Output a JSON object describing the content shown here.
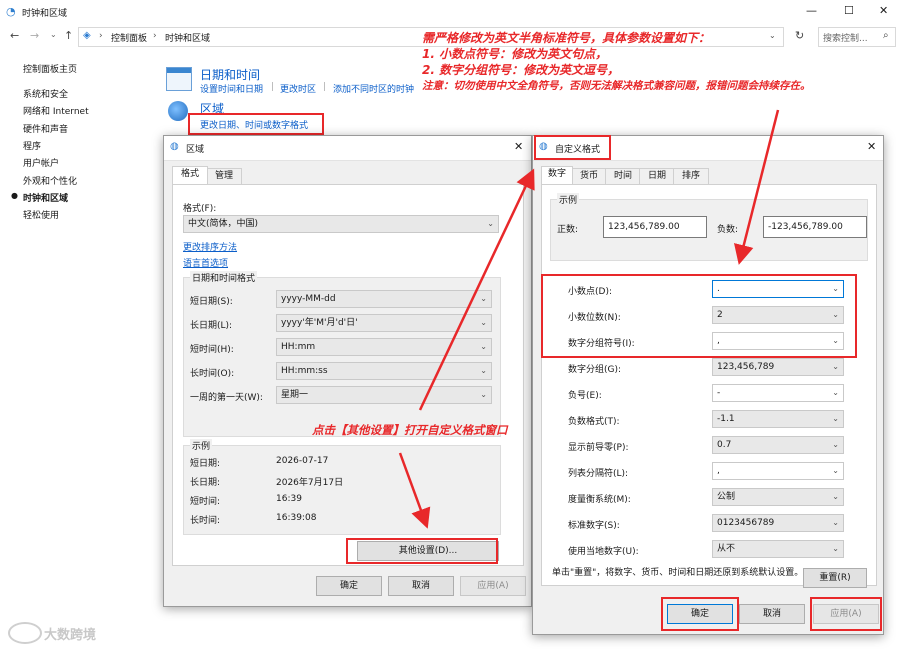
{
  "main_window": {
    "title": "时钟和区域",
    "address": [
      "控制面板",
      "时钟和区域"
    ],
    "search_placeholder": "搜索控制...",
    "win_controls": [
      "—",
      "☐",
      "✕"
    ]
  },
  "left_nav": {
    "items": [
      "控制面板主页",
      "系统和安全",
      "网络和 Internet",
      "硬件和声音",
      "程序",
      "用户帐户",
      "外观和个性化",
      "时钟和区域",
      "轻松使用"
    ]
  },
  "sections": {
    "datetime_title": "日期和时间",
    "datetime_links": [
      "设置时间和日期",
      "更改时区",
      "添加不同时区的时钟"
    ],
    "region_title": "区域",
    "region_link": "更改日期、时间或数字格式"
  },
  "region_dialog": {
    "title": "区域",
    "tabs": [
      "格式",
      "管理"
    ],
    "format_label": "格式(F):",
    "format_value": "中文(简体，中国)",
    "link_sort": "更改排序方法",
    "link_lang": "语言首选项",
    "group_title": "日期和时间格式",
    "rows": [
      {
        "label": "短日期(S):",
        "value": "yyyy-MM-dd"
      },
      {
        "label": "长日期(L):",
        "value": "yyyy'年'M'月'd'日'"
      },
      {
        "label": "短时间(H):",
        "value": "HH:mm"
      },
      {
        "label": "长时间(O):",
        "value": "HH:mm:ss"
      },
      {
        "label": "一周的第一天(W):",
        "value": "星期一"
      }
    ],
    "example_title": "示例",
    "examples": [
      {
        "label": "短日期:",
        "value": "2026-07-17"
      },
      {
        "label": "长日期:",
        "value": "2026年7月17日"
      },
      {
        "label": "短时间:",
        "value": "16:39"
      },
      {
        "label": "长时间:",
        "value": "16:39:08"
      }
    ],
    "other_settings_button": "其他设置(D)...",
    "ok": "确定",
    "cancel": "取消",
    "apply": "应用(A)"
  },
  "custom_dialog": {
    "title": "自定义格式",
    "tabs": [
      "数字",
      "货币",
      "时间",
      "日期",
      "排序"
    ],
    "example_title": "示例",
    "positive_label": "正数:",
    "positive_value": "123,456,789.00",
    "negative_label": "负数:",
    "negative_value": "-123,456,789.00",
    "rows": [
      {
        "label": "小数点(D):",
        "value": "."
      },
      {
        "label": "小数位数(N):",
        "value": "2"
      },
      {
        "label": "数字分组符号(I):",
        "value": ","
      },
      {
        "label": "数字分组(G):",
        "value": "123,456,789"
      },
      {
        "label": "负号(E):",
        "value": "-"
      },
      {
        "label": "负数格式(T):",
        "value": "-1.1"
      },
      {
        "label": "显示前导零(P):",
        "value": "0.7"
      },
      {
        "label": "列表分隔符(L):",
        "value": ","
      },
      {
        "label": "度量衡系统(M):",
        "value": "公制"
      },
      {
        "label": "标准数字(S):",
        "value": "0123456789"
      },
      {
        "label": "使用当地数字(U):",
        "value": "从不"
      }
    ],
    "reset_note": "单击\"重置\"，将数字、货币、时间和日期还原到系统默认设置。",
    "reset_button": "重置(R)",
    "ok": "确定",
    "cancel": "取消",
    "apply": "应用(A)"
  },
  "annotations": {
    "top_lines": [
      "需严格修改为英文半角标准符号，具体参数设置如下：",
      "1. 小数点符号：修改为英文句点，",
      "2. 数字分组符号：修改为英文逗号，",
      "注意：切勿使用中文全角符号，否则无法解决格式兼容问题，报错问题会持续存在。"
    ],
    "middle_text": "点击【其他设置】打开自定义格式窗口",
    "color": "#e8282a"
  },
  "watermark": "大数跨境"
}
